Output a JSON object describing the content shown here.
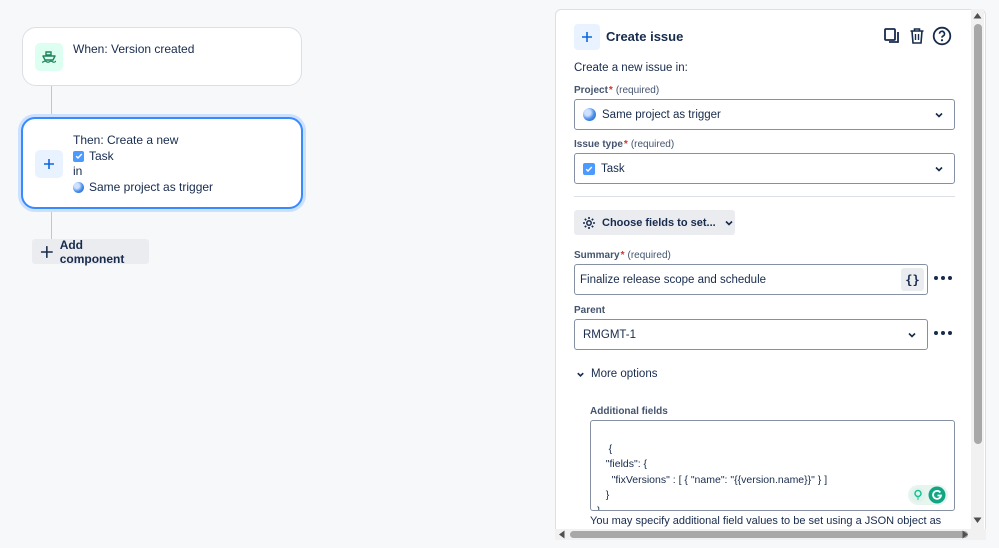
{
  "trigger": {
    "label": "When: Version created",
    "icon": "ship-icon"
  },
  "action": {
    "line1": "Then: Create a new",
    "issue_type": "Task",
    "in_label": "in",
    "project": "Same project as trigger",
    "icon": "plus-icon"
  },
  "add_component_label": "Add component",
  "panel": {
    "title": "Create issue",
    "subtitle": "Create a new issue in:",
    "icons": [
      "duplicate-icon",
      "trash-icon",
      "help-icon"
    ],
    "project_label": "Project",
    "required_hint": "(required)",
    "project_value": "Same project as trigger",
    "issue_type_label": "Issue type",
    "issue_type_value": "Task",
    "choose_fields_label": "Choose fields to set...",
    "summary_label": "Summary",
    "summary_value": "Finalize release scope and schedule",
    "smart_value_glyph": "{}",
    "parent_label": "Parent",
    "parent_value": "RMGMT-1",
    "more_options_label": "More options",
    "additional_fields_label": "Additional fields",
    "additional_fields_json": "{\n   \"fields\": {\n     \"fixVersions\" : [ { \"name\": \"{{version.name}}\" } ]\n   }\n}",
    "helper_text": "You may specify additional field values to be set using a JSON object as"
  },
  "colors": {
    "accent": "#388bff",
    "trigger_icon_bg": "#dcfff1",
    "trigger_icon_fg": "#1f845a",
    "required": "#c9372c"
  }
}
